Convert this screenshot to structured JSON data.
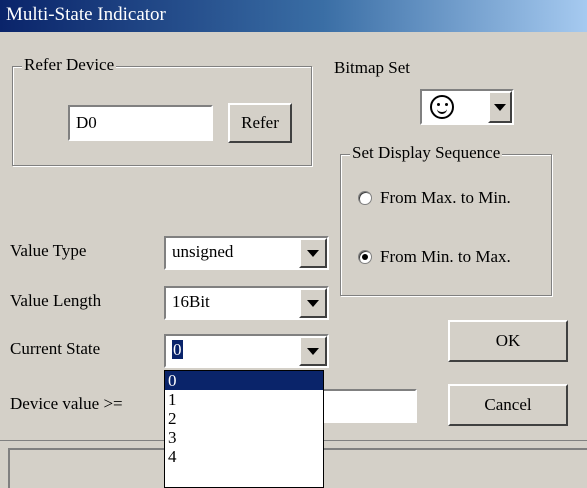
{
  "window": {
    "title": "Multi-State Indicator"
  },
  "refer_device": {
    "legend": "Refer Device",
    "value": "D0",
    "refer_label": "Refer"
  },
  "bitmap_set": {
    "label": "Bitmap Set",
    "selected_icon": "smiley-icon"
  },
  "display_sequence": {
    "legend": "Set Display Sequence",
    "options": [
      {
        "label": "From Max. to Min.",
        "selected": false
      },
      {
        "label": "From Min. to Max.",
        "selected": true
      }
    ]
  },
  "value_type": {
    "label": "Value Type",
    "value": "unsigned"
  },
  "value_length": {
    "label": "Value Length",
    "value": "16Bit"
  },
  "current_state": {
    "label": "Current State",
    "value": "0",
    "options": [
      "0",
      "1",
      "2",
      "3",
      "4"
    ]
  },
  "device_value": {
    "label": "Device value >=",
    "value": ""
  },
  "buttons": {
    "ok": "OK",
    "cancel": "Cancel"
  }
}
